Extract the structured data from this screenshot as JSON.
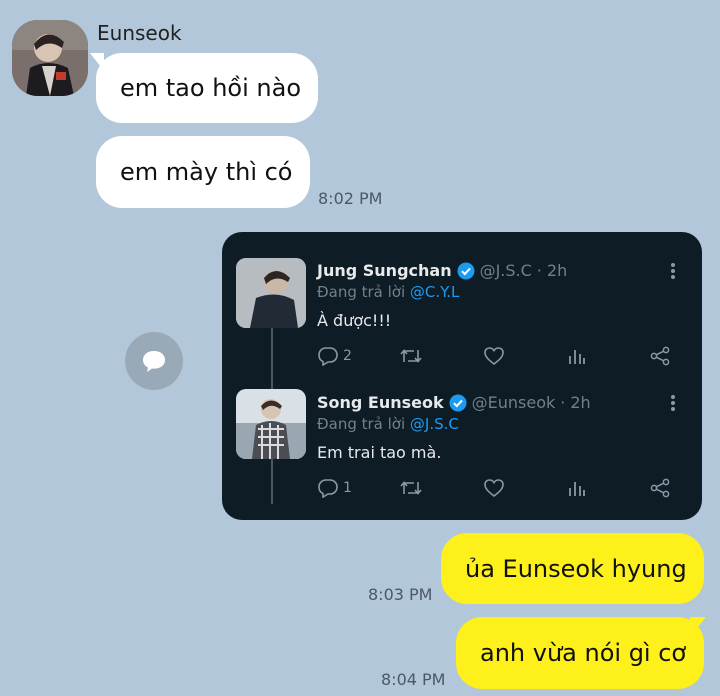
{
  "chat": {
    "sender_name": "Eunseok",
    "messages": [
      {
        "text": "em tao hồi nào"
      },
      {
        "text": "em mày thì có"
      },
      {
        "text": "ủa Eunseok hyung"
      },
      {
        "text": "anh vừa nói gì cơ"
      }
    ],
    "times": [
      "8:02 PM",
      "8:03 PM",
      "8:04 PM"
    ]
  },
  "tweets": [
    {
      "name": "Jung Sungchan",
      "handle": "@J.S.C",
      "sep": "·",
      "age": "2h",
      "reply_prefix": "Đang trả lời",
      "reply_to": "@C.Y.L",
      "text": "À được!!!",
      "reply_count": "2"
    },
    {
      "name": "Song Eunseok",
      "handle": "@Eunseok",
      "sep": "·",
      "age": "2h",
      "reply_prefix": "Đang trả lời",
      "reply_to": "@J.S.C",
      "text": "Em trai tao mà.",
      "reply_count": "1"
    }
  ],
  "colors": {
    "background": "#b2c7da",
    "my_bubble": "#fef01b",
    "their_bubble": "#ffffff",
    "card_bg": "#0e1c26",
    "mention": "#1d9bf0"
  },
  "icons": [
    "share-icon",
    "verified-icon",
    "more-icon",
    "reply-icon",
    "retweet-icon",
    "like-icon",
    "stats-icon",
    "share-tweet-icon"
  ]
}
